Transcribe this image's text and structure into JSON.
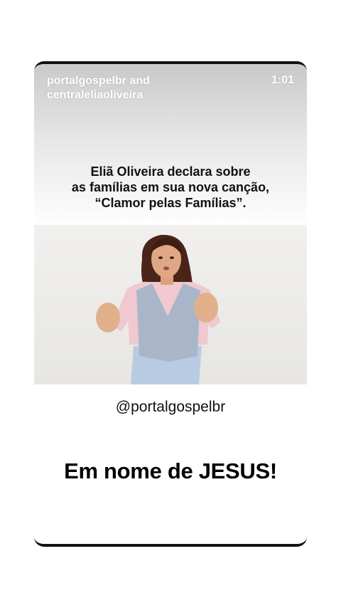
{
  "post": {
    "author": "portalgospelbr and centraleliaoliveira",
    "duration": "1:01",
    "caption_lines": [
      "Eliã Oliveira declara sobre",
      "as famílias em sua nova canção,",
      "“Clamor pelas Famílias”."
    ],
    "handle": "@portalgospelbr",
    "headline": "Em nome de JESUS!"
  }
}
